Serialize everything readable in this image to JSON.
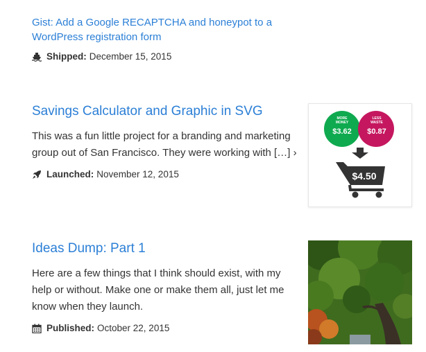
{
  "posts": [
    {
      "title_line1": "Gist: Add a Google RECAPTCHA and honeypot to a",
      "title_line2": "WordPress registration form",
      "meta_label": "Shipped:",
      "meta_date": "December 15, 2015",
      "icon": "ship-icon"
    },
    {
      "title": "Savings Calculator and Graphic in SVG",
      "excerpt_line1": "This was a fun little project for a branding and marketing",
      "excerpt_line2": "group out of San Francisco. They were working with […]",
      "more": "›",
      "meta_label": "Launched:",
      "meta_date": "November 12, 2015",
      "icon": "rocket-icon",
      "graphic": {
        "left_circle_top": "MORE",
        "left_circle_mid": "MONEY",
        "left_circle_value": "$3.62",
        "right_circle_top": "LESS",
        "right_circle_mid": "WASTE",
        "right_circle_value": "$0.87",
        "cart_value": "$4.50",
        "colors": {
          "green": "#0faa4f",
          "magenta": "#c5175f",
          "dark": "#333333"
        }
      }
    },
    {
      "title": "Ideas Dump: Part 1",
      "excerpt_line1": "Here are a few things that I think should exist, with my",
      "excerpt_line2": "help or without. Make one or make them all, just let me",
      "excerpt_line3": "know when they launch.",
      "meta_label": "Published:",
      "meta_date": "October 22, 2015",
      "icon": "calendar-icon",
      "image": "tree-photo"
    }
  ],
  "colors": {
    "link": "#2b7fd6",
    "text": "#333333"
  }
}
